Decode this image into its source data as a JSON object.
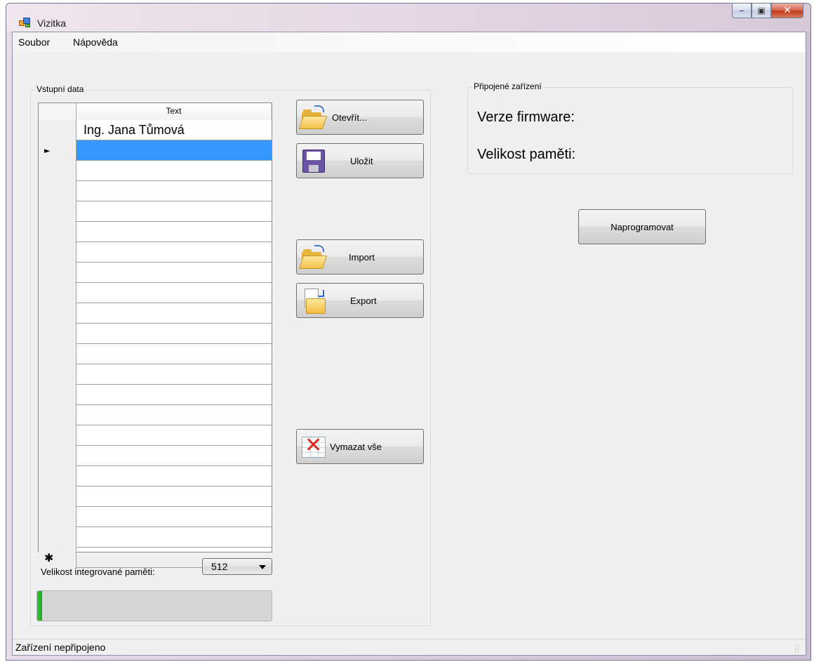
{
  "window": {
    "title": "Vizitka"
  },
  "menu": {
    "items": [
      "Soubor",
      "Nápověda"
    ]
  },
  "input_group": {
    "title": "Vstupní data",
    "grid": {
      "columns": [
        "Text"
      ],
      "rows": [
        {
          "text": "Ing. Jana Tůmová",
          "marker": ""
        },
        {
          "text": "",
          "marker": "►",
          "selected": true
        },
        {
          "text": ""
        },
        {
          "text": ""
        },
        {
          "text": ""
        },
        {
          "text": ""
        },
        {
          "text": ""
        },
        {
          "text": ""
        },
        {
          "text": ""
        },
        {
          "text": ""
        },
        {
          "text": ""
        },
        {
          "text": ""
        },
        {
          "text": ""
        },
        {
          "text": ""
        },
        {
          "text": ""
        },
        {
          "text": ""
        },
        {
          "text": ""
        },
        {
          "text": ""
        },
        {
          "text": ""
        },
        {
          "text": ""
        },
        {
          "text": ""
        },
        {
          "text": "",
          "marker": "✱"
        }
      ]
    },
    "memory_label": "Velikost integrované paměti:",
    "memory_value": "512",
    "progress_percent": 2
  },
  "buttons": {
    "open": "Otevřít...",
    "save": "Uložit",
    "import": "Import",
    "export": "Export",
    "clear_all": "Vymazat vše",
    "program": "Naprogramovat"
  },
  "device_group": {
    "title": "Připojené zařízení",
    "firmware_label": "Verze firmware:",
    "memory_label": "Velikost paměti:"
  },
  "status": {
    "text": "Zařízení nepřipojeno"
  },
  "icons": {
    "app": "app-icon",
    "open": "folder-open-icon",
    "save": "floppy-disk-icon",
    "import": "folder-open-icon",
    "export": "export-icon",
    "clear_all": "clear-grid-icon",
    "dropdown": "chevron-down-icon"
  },
  "colors": {
    "selection": "#3399ff",
    "progress": "#1fa81f",
    "close_button": "#c2391d"
  }
}
